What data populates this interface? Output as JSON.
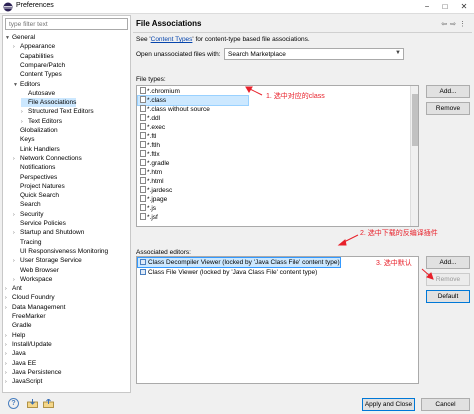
{
  "window": {
    "title": "Preferences"
  },
  "filter": {
    "placeholder": "type filter text"
  },
  "tree": [
    {
      "label": "General",
      "arrow": "▼"
    },
    {
      "label": "Appearance",
      "arrow": "›"
    },
    {
      "label": "Capabilities",
      "arrow": ""
    },
    {
      "label": "Compare/Patch",
      "arrow": ""
    },
    {
      "label": "Content Types",
      "arrow": ""
    },
    {
      "label": "Editors",
      "arrow": "▼"
    },
    {
      "label": "Autosave",
      "arrow": ""
    },
    {
      "label": "File Associations",
      "arrow": "",
      "selected": true
    },
    {
      "label": "Structured Text Editors",
      "arrow": "›"
    },
    {
      "label": "Text Editors",
      "arrow": "›"
    },
    {
      "label": "Globalization",
      "arrow": ""
    },
    {
      "label": "Keys",
      "arrow": ""
    },
    {
      "label": "Link Handlers",
      "arrow": ""
    },
    {
      "label": "Network Connections",
      "arrow": "›"
    },
    {
      "label": "Notifications",
      "arrow": ""
    },
    {
      "label": "Perspectives",
      "arrow": ""
    },
    {
      "label": "Project Natures",
      "arrow": ""
    },
    {
      "label": "Quick Search",
      "arrow": ""
    },
    {
      "label": "Search",
      "arrow": ""
    },
    {
      "label": "Security",
      "arrow": "›"
    },
    {
      "label": "Service Policies",
      "arrow": ""
    },
    {
      "label": "Startup and Shutdown",
      "arrow": "›"
    },
    {
      "label": "Tracing",
      "arrow": ""
    },
    {
      "label": "UI Responsiveness Monitoring",
      "arrow": ""
    },
    {
      "label": "User Storage Service",
      "arrow": "›"
    },
    {
      "label": "Web Browser",
      "arrow": ""
    },
    {
      "label": "Workspace",
      "arrow": "›"
    },
    {
      "label": "Ant",
      "arrow": "›"
    },
    {
      "label": "Cloud Foundry",
      "arrow": "›"
    },
    {
      "label": "Data Management",
      "arrow": "›"
    },
    {
      "label": "FreeMarker",
      "arrow": ""
    },
    {
      "label": "Gradle",
      "arrow": ""
    },
    {
      "label": "Help",
      "arrow": "›"
    },
    {
      "label": "Install/Update",
      "arrow": "›"
    },
    {
      "label": "Java",
      "arrow": "›"
    },
    {
      "label": "Java EE",
      "arrow": "›"
    },
    {
      "label": "Java Persistence",
      "arrow": "›"
    },
    {
      "label": "JavaScript",
      "arrow": "›"
    }
  ],
  "page": {
    "title": "File Associations",
    "desc_prefix": "See '",
    "desc_link": "Content Types",
    "desc_suffix": "' for content-type based file associations.",
    "open_label": "Open unassociated files with:",
    "open_value": "Search Marketplace",
    "file_types_label": "File types:",
    "file_types": [
      "*.chromium",
      "*.class",
      "*.class without source",
      "*.ddl",
      "*.exec",
      "*.ftl",
      "*.ftlh",
      "*.ftlx",
      "*.gradle",
      "*.htm",
      "*.html",
      "*.jardesc",
      "*.jpage",
      "*.js",
      "*.jsf"
    ],
    "associated_label": "Associated editors:",
    "editors": [
      "Class Decompiler Viewer (locked by 'Java Class File' content type)",
      "Class File Viewer (locked by 'Java Class File' content type)"
    ],
    "buttons": {
      "add_ft": "Add...",
      "remove_ft": "Remove",
      "add_ed": "Add...",
      "remove_ed": "Remove",
      "default_ed": "Default"
    }
  },
  "annotations": {
    "a1": "1. 选中对应的class",
    "a2": "2. 选中下载的反编译插件",
    "a3": "3. 选中默认"
  },
  "footer": {
    "apply_close": "Apply and Close",
    "cancel": "Cancel"
  },
  "colors": {
    "annotation": "#e8202a",
    "selection": "#cce8ff",
    "link": "#0645ad"
  },
  "icons": {
    "help": "help-icon",
    "import": "import-icon",
    "export": "export-icon"
  }
}
